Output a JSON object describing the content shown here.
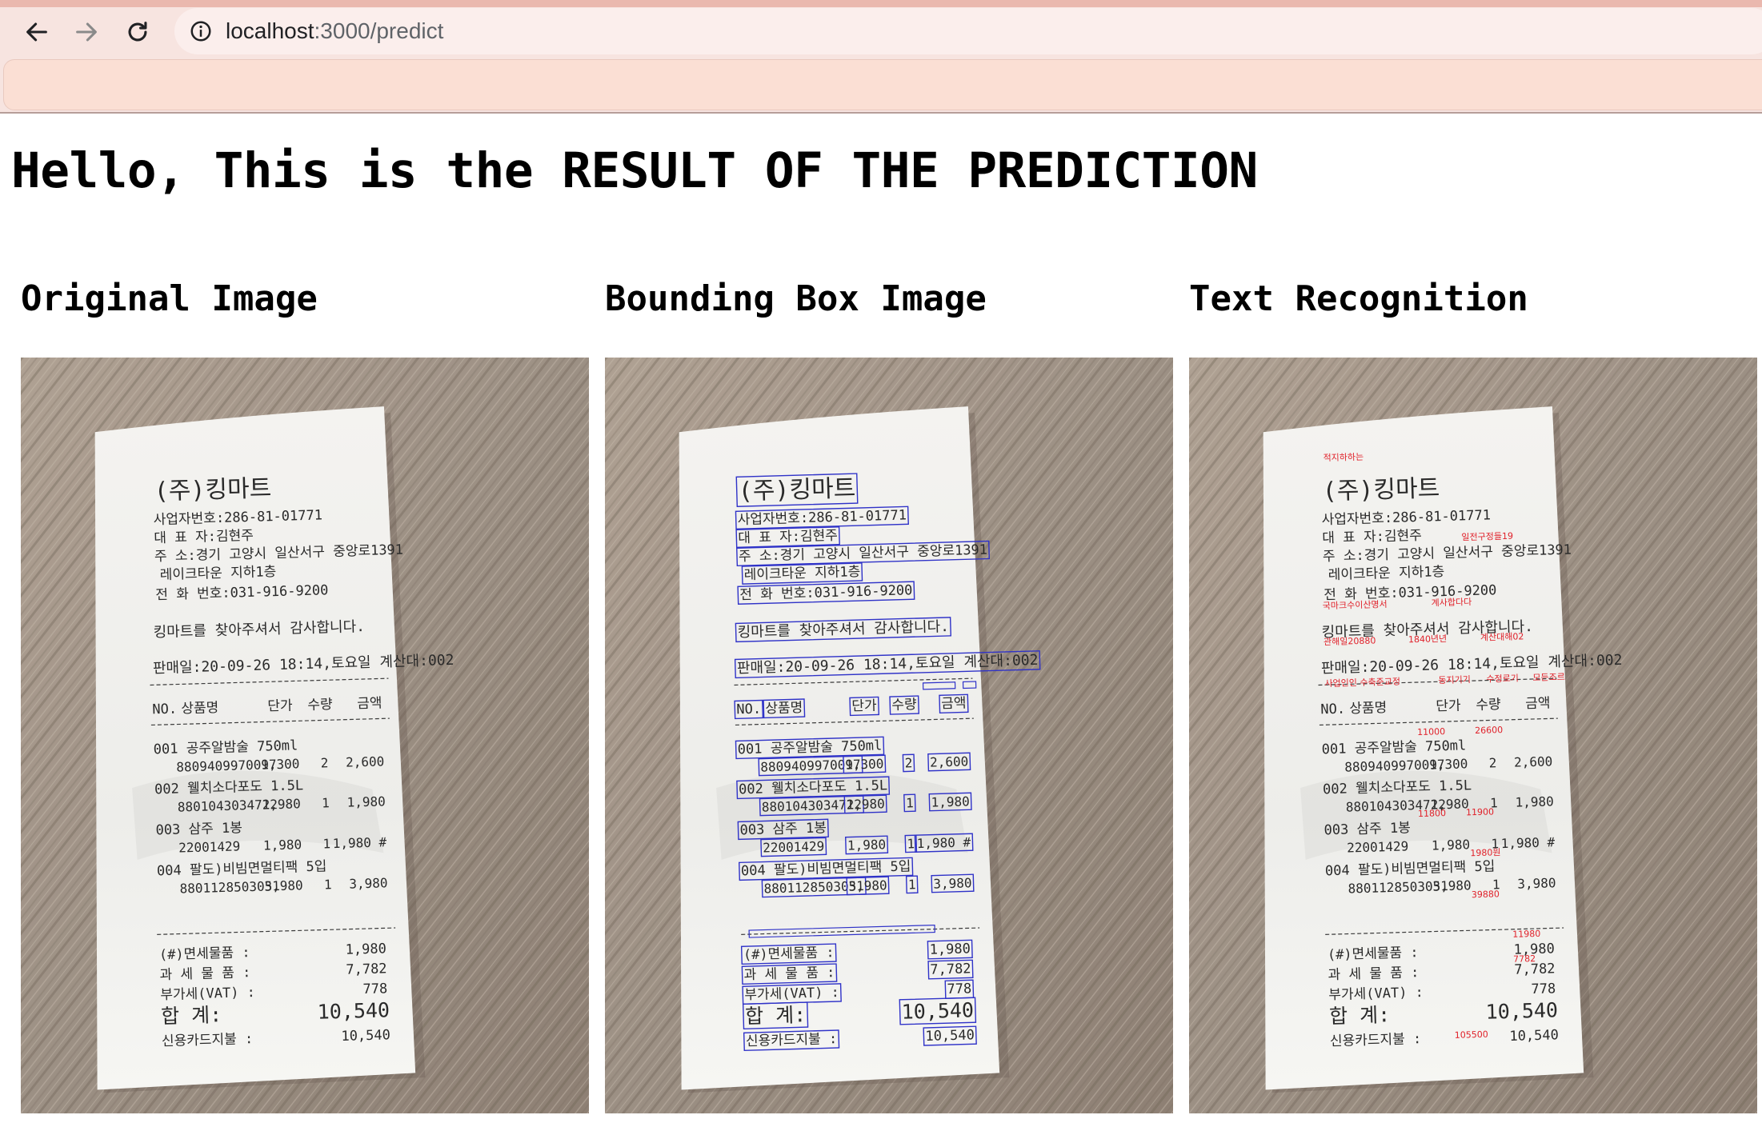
{
  "browser": {
    "url_host": "localhost",
    "url_path": ":3000/predict"
  },
  "page": {
    "title": "Hello, This is the RESULT OF THE PREDICTION"
  },
  "columns": [
    {
      "heading": "Original Image"
    },
    {
      "heading": "Bounding Box Image"
    },
    {
      "heading": "Text Recognition"
    }
  ],
  "receipt": {
    "store": "(주)킹마트",
    "biz_no": "사업자번호:286-81-01771",
    "owner": "대  표  자:김현주",
    "address": "주      소:경기 고양시 일산서구 중앙로1391",
    "address2": "레이크타운 지하1층",
    "phone": "전 화 번호:031-916-9200",
    "thanks": "킹마트를 찾아주셔서 감사합니다.",
    "sale_info": "판매일:20-09-26 18:14,토요일 계산대:002",
    "header": {
      "no": "NO.",
      "name": "상품명",
      "price": "단가",
      "qty": "수량",
      "amount": "금액"
    },
    "items": [
      {
        "line1": "001 공주알밤술 750ml",
        "code": "8809409970097",
        "price": "1,300",
        "qty": "2",
        "amount": "2,600"
      },
      {
        "line1": "002 웰치소다포도 1.5L",
        "code": "8801043034722",
        "price": "1,980",
        "qty": "1",
        "amount": "1,980"
      },
      {
        "line1": "003 삼주 1봉",
        "code": "22001429",
        "price": "1,980",
        "qty": "1",
        "amount": "1,980 #"
      },
      {
        "line1": "004 팔도)비빔면멀티팩 5입",
        "code": "8801128503051",
        "price": "3,980",
        "qty": "1",
        "amount": "3,980"
      }
    ],
    "totals": [
      {
        "label": "(#)면세물품 :",
        "value": "1,980"
      },
      {
        "label": "과 세 물 품 :",
        "value": "7,782"
      },
      {
        "label": "부가세(VAT) :",
        "value": "778"
      }
    ],
    "grand_label": "합    계:",
    "grand_value": "10,540",
    "card_label": "신용카드지불 :",
    "card_value": "10,540"
  },
  "ocr_overlay": [
    "적지하하는",
    "일전구정들19",
    "국마크수이산명서",
    "계사합다다",
    "관해일20880",
    "1840년년",
    "계산대해02",
    "사업인인 수축준교정",
    "동지기기",
    "수정로기",
    "모든조르",
    "11000",
    "26600",
    "11800",
    "11900",
    "1980원",
    "39880",
    "105500",
    "7782",
    "11980"
  ],
  "colors": {
    "chrome_bg": "#f7e4e0",
    "subbar_bg": "#fbdfd4",
    "bbox_stroke": "#2f32c8",
    "ocr_text": "#e0212a",
    "paper": "#f6f5f2",
    "floor": "#a89a8c"
  },
  "icons": [
    "back-arrow-icon",
    "forward-arrow-icon",
    "reload-icon",
    "info-icon"
  ]
}
